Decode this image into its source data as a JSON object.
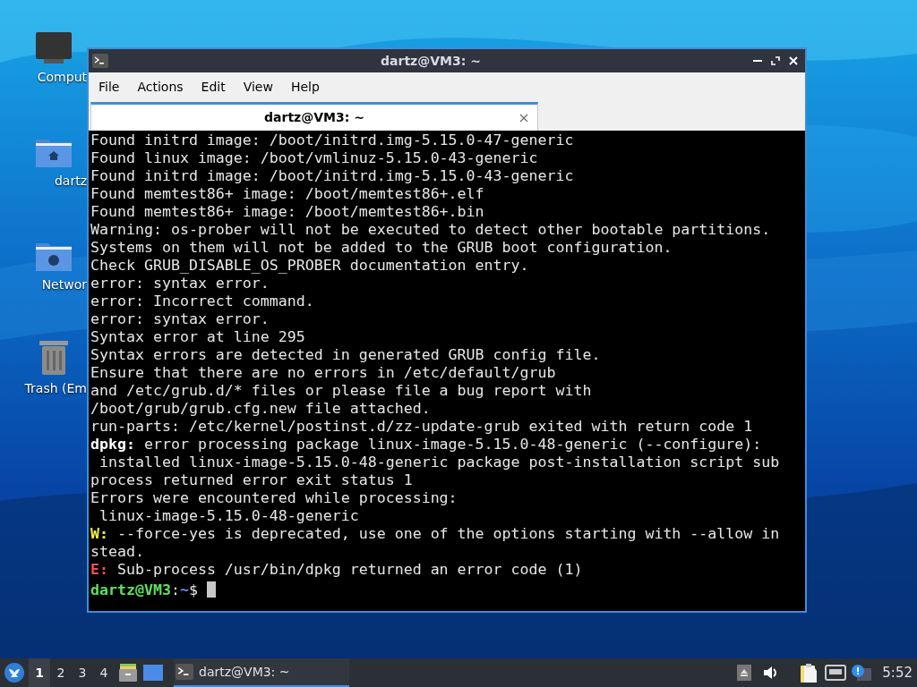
{
  "desktop_icons": [
    {
      "kind": "computer",
      "label": "Comput"
    },
    {
      "kind": "home",
      "label": "dartz"
    },
    {
      "kind": "network",
      "label": "Networ"
    },
    {
      "kind": "trash",
      "label": "Trash (Em"
    }
  ],
  "window": {
    "title": "dartz@VM3: ~",
    "menu": [
      "File",
      "Actions",
      "Edit",
      "View",
      "Help"
    ],
    "tabs": [
      {
        "label": "dartz@VM3: ~",
        "selected": true
      }
    ],
    "terminal_lines": [
      [
        {
          "kind": "plain",
          "text": "Found initrd image: /boot/initrd.img-5.15.0-47-generic"
        }
      ],
      [
        {
          "kind": "plain",
          "text": "Found linux image: /boot/vmlinuz-5.15.0-43-generic"
        }
      ],
      [
        {
          "kind": "plain",
          "text": "Found initrd image: /boot/initrd.img-5.15.0-43-generic"
        }
      ],
      [
        {
          "kind": "plain",
          "text": "Found memtest86+ image: /boot/memtest86+.elf"
        }
      ],
      [
        {
          "kind": "plain",
          "text": "Found memtest86+ image: /boot/memtest86+.bin"
        }
      ],
      [
        {
          "kind": "plain",
          "text": "Warning: os-prober will not be executed to detect other bootable partitions."
        }
      ],
      [
        {
          "kind": "plain",
          "text": "Systems on them will not be added to the GRUB boot configuration."
        }
      ],
      [
        {
          "kind": "plain",
          "text": "Check GRUB_DISABLE_OS_PROBER documentation entry."
        }
      ],
      [
        {
          "kind": "plain",
          "text": "error: syntax error."
        }
      ],
      [
        {
          "kind": "plain",
          "text": "error: Incorrect command."
        }
      ],
      [
        {
          "kind": "plain",
          "text": "error: syntax error."
        }
      ],
      [
        {
          "kind": "plain",
          "text": "Syntax error at line 295"
        }
      ],
      [
        {
          "kind": "plain",
          "text": "Syntax errors are detected in generated GRUB config file."
        }
      ],
      [
        {
          "kind": "plain",
          "text": "Ensure that there are no errors in /etc/default/grub"
        }
      ],
      [
        {
          "kind": "plain",
          "text": "and /etc/grub.d/* files or please file a bug report with"
        }
      ],
      [
        {
          "kind": "plain",
          "text": "/boot/grub/grub.cfg.new file attached."
        }
      ],
      [
        {
          "kind": "plain",
          "text": "run-parts: /etc/kernel/postinst.d/zz-update-grub exited with return code 1"
        }
      ],
      [
        {
          "kind": "bold",
          "text": "dpkg:"
        },
        {
          "kind": "plain",
          "text": " error processing package linux-image-5.15.0-48-generic (--configure):"
        }
      ],
      [
        {
          "kind": "plain",
          "text": " installed linux-image-5.15.0-48-generic package post-installation script sub"
        }
      ],
      [
        {
          "kind": "plain",
          "text": "process returned error exit status 1"
        }
      ],
      [
        {
          "kind": "plain",
          "text": "Errors were encountered while processing:"
        }
      ],
      [
        {
          "kind": "plain",
          "text": " linux-image-5.15.0-48-generic"
        }
      ],
      [
        {
          "kind": "warning",
          "text": "W:"
        },
        {
          "kind": "plain",
          "text": " --force-yes is deprecated, use one of the options starting with --allow in"
        }
      ],
      [
        {
          "kind": "plain",
          "text": "stead."
        }
      ],
      [
        {
          "kind": "error",
          "text": "E:"
        },
        {
          "kind": "plain",
          "text": " Sub-process /usr/bin/dpkg returned an error code (1)"
        }
      ],
      [
        {
          "kind": "user",
          "text": "dartz@VM3"
        },
        {
          "kind": "plain",
          "text": ":"
        },
        {
          "kind": "path",
          "text": "~"
        },
        {
          "kind": "plain",
          "text": "$ "
        },
        {
          "kind": "cursor"
        }
      ]
    ]
  },
  "taskbar": {
    "workspaces": [
      {
        "label": "1",
        "selected": true
      },
      {
        "label": "2",
        "selected": false
      },
      {
        "label": "3",
        "selected": false
      },
      {
        "label": "4",
        "selected": false
      }
    ],
    "tasks": [
      {
        "label": "dartz@VM3: ~",
        "selected": true
      }
    ],
    "clock": "5:52"
  }
}
